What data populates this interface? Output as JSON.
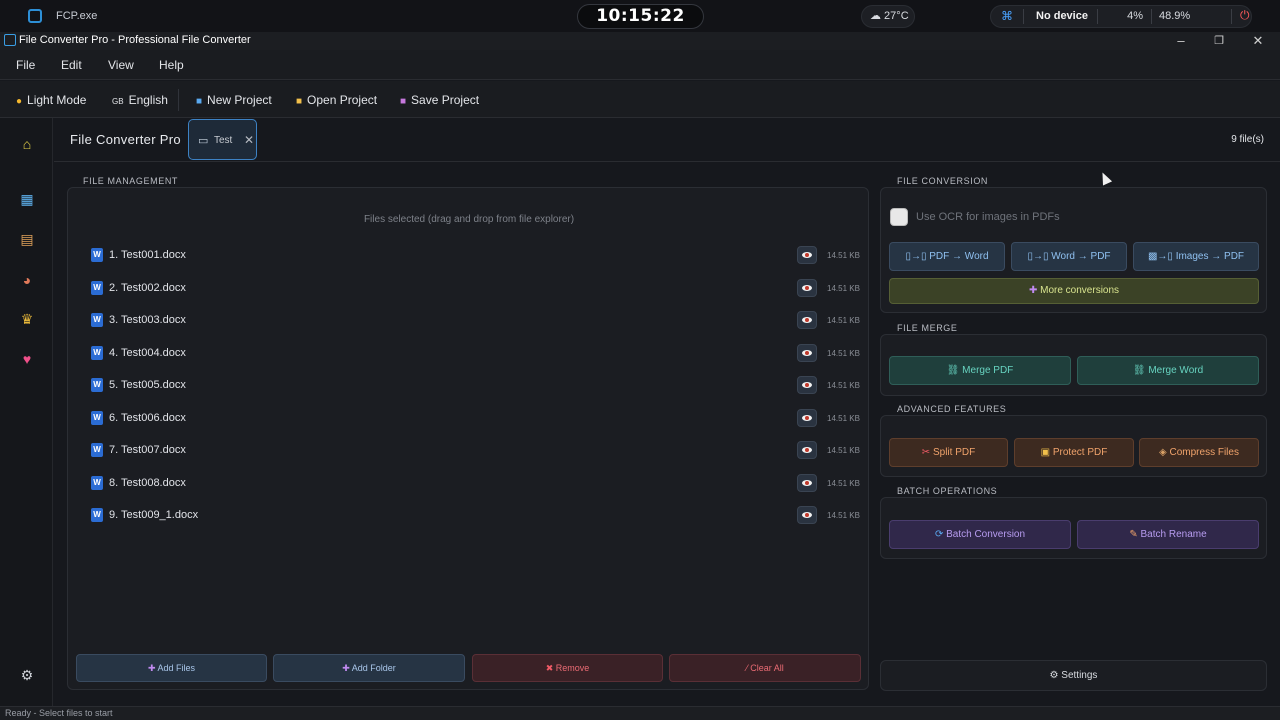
{
  "system_bar": {
    "app_name": "FCP.exe",
    "clock": "10:15:22",
    "weather": "☁ 27°C",
    "device": "No device",
    "cpu": "4%",
    "memory": "48.9%"
  },
  "window": {
    "title": "File Converter Pro - Professional File Converter"
  },
  "menu": [
    "File",
    "Edit",
    "View",
    "Help"
  ],
  "toolbar": {
    "theme": "Light Mode",
    "language": "English",
    "language_flag": "GB",
    "new_project": "New Project",
    "open_project": "Open Project",
    "save_project": "Save Project"
  },
  "header": {
    "app_name": "File Converter Pro",
    "project_tab": "Test",
    "file_count": "9 file(s)"
  },
  "file_management": {
    "label": "FILE MANAGEMENT",
    "hint": "Files selected (drag and drop from file explorer)",
    "files": [
      {
        "name": "1. Test001.docx",
        "size": "14.51 KB"
      },
      {
        "name": "2. Test002.docx",
        "size": "14.51 KB"
      },
      {
        "name": "3. Test003.docx",
        "size": "14.51 KB"
      },
      {
        "name": "4. Test004.docx",
        "size": "14.51 KB"
      },
      {
        "name": "5. Test005.docx",
        "size": "14.51 KB"
      },
      {
        "name": "6. Test006.docx",
        "size": "14.51 KB"
      },
      {
        "name": "7. Test007.docx",
        "size": "14.51 KB"
      },
      {
        "name": "8. Test008.docx",
        "size": "14.51 KB"
      },
      {
        "name": "9. Test009_1.docx",
        "size": "14.51 KB"
      }
    ],
    "add_files": "Add Files",
    "add_folder": "Add Folder",
    "remove": "Remove",
    "clear_all": "Clear All"
  },
  "file_conversion": {
    "label": "FILE CONVERSION",
    "ocr_label": "Use OCR for images in PDFs",
    "pdf_to_word": "PDF → Word",
    "word_to_pdf": "Word → PDF",
    "images_to_pdf": "Images → PDF",
    "more": "More conversions"
  },
  "file_merge": {
    "label": "FILE MERGE",
    "merge_pdf": "Merge PDF",
    "merge_word": "Merge Word"
  },
  "advanced": {
    "label": "ADVANCED FEATURES",
    "split_pdf": "Split PDF",
    "protect_pdf": "Protect PDF",
    "compress": "Compress Files"
  },
  "batch": {
    "label": "BATCH OPERATIONS",
    "conversion": "Batch Conversion",
    "rename": "Batch Rename"
  },
  "settings": "Settings",
  "status": "Ready - Select files to start"
}
